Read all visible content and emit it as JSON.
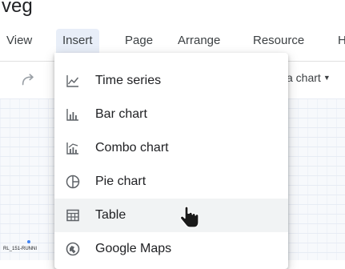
{
  "document": {
    "title": "veg"
  },
  "menubar": {
    "items": [
      {
        "label": "View"
      },
      {
        "label": "Insert"
      },
      {
        "label": "Page"
      },
      {
        "label": "Arrange"
      },
      {
        "label": "Resource"
      },
      {
        "label": "H"
      }
    ],
    "active": "Insert"
  },
  "toolbar": {
    "add_chart_label": "a chart"
  },
  "canvas": {
    "tiny_label": "RL_151-RUNNI"
  },
  "insert_menu": {
    "items": [
      {
        "label": "Time series",
        "icon": "time-series-icon"
      },
      {
        "label": "Bar chart",
        "icon": "bar-chart-icon"
      },
      {
        "label": "Combo chart",
        "icon": "combo-chart-icon"
      },
      {
        "label": "Pie chart",
        "icon": "pie-chart-icon"
      },
      {
        "label": "Table",
        "icon": "table-icon"
      },
      {
        "label": "Google Maps",
        "icon": "google-maps-icon"
      }
    ],
    "hovered": "Table"
  },
  "colors": {
    "active_menu_bg": "#e8eef8",
    "hover_item_bg": "#f1f3f4",
    "icon_gray": "#5f6368",
    "text": "#202124"
  }
}
